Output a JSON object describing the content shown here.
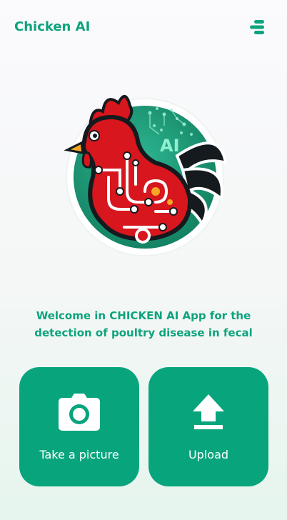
{
  "header": {
    "title": "Chicken AI",
    "menu_icon": "menu-icon"
  },
  "logo": {
    "badge_text": "AI",
    "icon": "chicken-circuit-logo"
  },
  "welcome": {
    "text": "Welcome in CHICKEN AI App for the detection of poultry disease in fecal"
  },
  "actions": {
    "picture": {
      "label": "Take a picture",
      "icon": "camera-icon"
    },
    "upload": {
      "label": "Upload",
      "icon": "upload-icon"
    }
  },
  "colors": {
    "accent": "#08a57d",
    "title_green": "#0ea37d",
    "chicken_red": "#d7161d"
  }
}
